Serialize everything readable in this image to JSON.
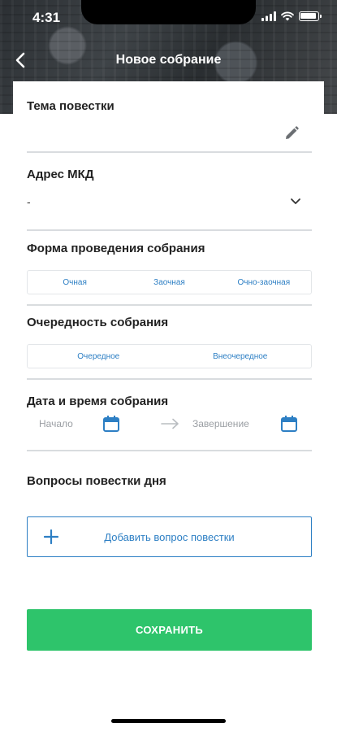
{
  "status_bar": {
    "time": "4:31"
  },
  "nav": {
    "title": "Новое собрание"
  },
  "form": {
    "topic": {
      "label": "Тема повестки",
      "value": ""
    },
    "address": {
      "label": "Адрес МКД",
      "value": "-"
    },
    "form_type": {
      "label": "Форма проведения собрания",
      "options": [
        "Очная",
        "Заочная",
        "Очно-заочная"
      ]
    },
    "order": {
      "label": "Очередность собрания",
      "options": [
        "Очередное",
        "Внеочередное"
      ]
    },
    "datetime": {
      "label": "Дата и время собрания",
      "start_placeholder": "Начало",
      "end_placeholder": "Завершение"
    },
    "questions": {
      "label": "Вопросы повестки дня",
      "add_label": "Добавить вопрос повестки"
    }
  },
  "save_label": "СОХРАНИТЬ",
  "colors": {
    "accent": "#2d7fc4",
    "save": "#2ec46b",
    "divider": "#d9dcdf"
  }
}
